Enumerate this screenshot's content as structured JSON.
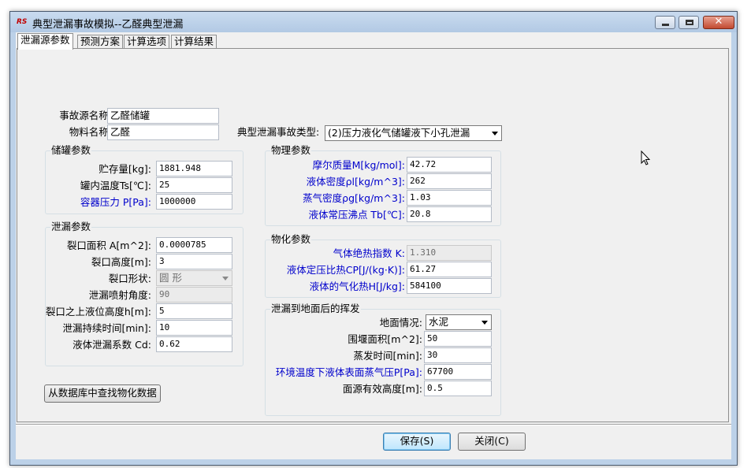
{
  "window": {
    "icon_text": "RS",
    "title": "典型泄漏事故模拟--乙醛典型泄漏",
    "close_glyph": "✕"
  },
  "tabs": [
    {
      "label": "泄漏源参数"
    },
    {
      "label": "预测方案"
    },
    {
      "label": "计算选项"
    },
    {
      "label": "计算结果"
    }
  ],
  "source": {
    "name_label": "事故源名称:",
    "name_value": "乙醛储罐",
    "material_label": "物料名称:",
    "material_value": "乙醛",
    "type_label": "典型泄漏事故类型:",
    "type_value": "(2)压力液化气储罐液下小孔泄漏"
  },
  "tank": {
    "title": "储罐参数",
    "storage_label": "贮存量[kg]:",
    "storage_value": "1881.948",
    "temp_label": "罐内温度Ts[℃]:",
    "temp_value": "25",
    "pressure_label": "容器压力 P[Pa]:",
    "pressure_value": "1000000"
  },
  "leak": {
    "title": "泄漏参数",
    "area_label": "裂口面积 A[m^2]:",
    "area_value": "0.0000785",
    "height_label": "裂口高度[m]:",
    "height_value": "3",
    "shape_label": "裂口形状:",
    "shape_value": "圆  形",
    "angle_label": "泄漏喷射角度:",
    "angle_value": "90",
    "level_label": "裂口之上液位高度h[m]:",
    "level_value": "5",
    "duration_label": "泄漏持续时间[min]:",
    "duration_value": "10",
    "coef_label": "液体泄漏系数  Cd:",
    "coef_value": "0.62"
  },
  "physical": {
    "title": "物理参数",
    "molar_label": "摩尔质量M[kg/mol]:",
    "molar_value": "42.72",
    "liq_density_label": "液体密度ρl[kg/m^3]:",
    "liq_density_value": "262",
    "vap_density_label": "蒸气密度ρg[kg/m^3]:",
    "vap_density_value": "1.03",
    "boiling_label": "液体常压沸点 Tb[℃]:",
    "boiling_value": "20.8"
  },
  "chemical": {
    "title": "物化参数",
    "adiabatic_label": "气体绝热指数  K:",
    "adiabatic_value": "1.310",
    "heat_cap_label": "液体定压比热CP[J/(kg·K)]:",
    "heat_cap_value": "61.27",
    "vap_heat_label": "液体的气化热H[J/kg]:",
    "vap_heat_value": "584100"
  },
  "evap": {
    "title": "泄漏到地面后的挥发",
    "ground_label": "地面情况:",
    "ground_value": "水泥",
    "dike_label": "围堰面积[m^2]:",
    "dike_value": "50",
    "evap_time_label": "蒸发时间[min]:",
    "evap_time_value": "30",
    "vp_label": "环境温度下液体表面蒸气压P[Pa]:",
    "vp_value": "67700",
    "src_height_label": "面源有效高度[m]:",
    "src_height_value": "0.5"
  },
  "buttons": {
    "lookup": "从数据库中查找物化数据",
    "save": "保存(S)",
    "close": "关闭(C)"
  }
}
